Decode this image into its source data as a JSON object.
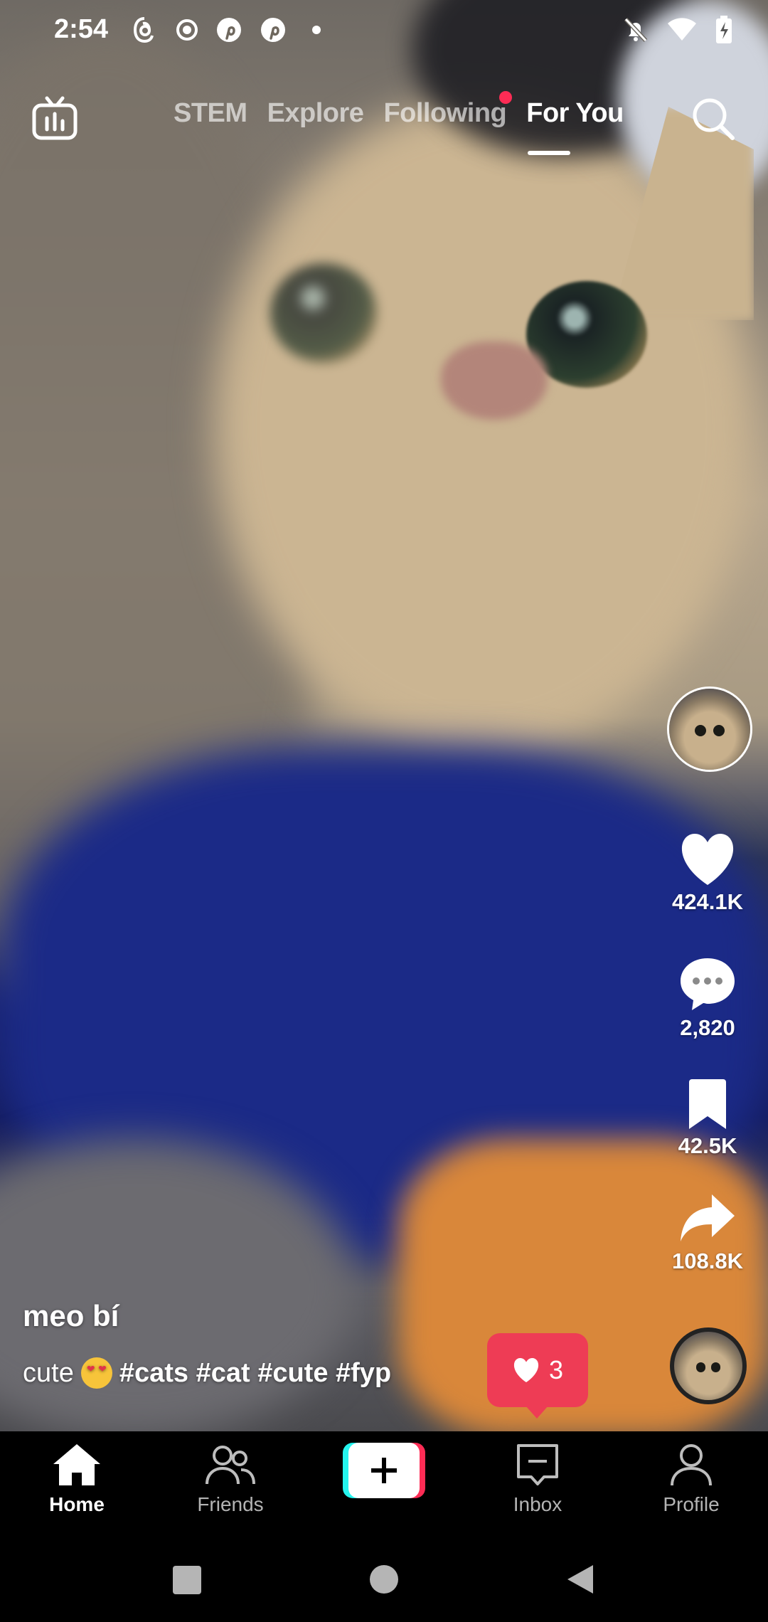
{
  "status_bar": {
    "time": "2:54",
    "left_icons": [
      "threads-icon",
      "record-icon",
      "pinterest-icon",
      "pinterest-icon",
      "dot-icon"
    ],
    "right_icons": [
      "bell-off-icon",
      "wifi-icon",
      "battery-charging-icon"
    ]
  },
  "top_nav": {
    "tabs": [
      "STEM",
      "Explore",
      "Following",
      "For You"
    ],
    "active_tab": "For You",
    "following_has_notification": true
  },
  "actions": {
    "likes": "424.1K",
    "comments": "2,820",
    "saves": "42.5K",
    "shares": "108.8K"
  },
  "caption": {
    "username": "meo bí",
    "text": "cute",
    "hashtags": "#cats #cat #cute #fyp"
  },
  "like_bubble": {
    "count": "3"
  },
  "bottom_nav": {
    "home": "Home",
    "friends": "Friends",
    "inbox": "Inbox",
    "profile": "Profile"
  },
  "colors": {
    "accent": "#fe2c55",
    "create_cyan": "#25f4ee",
    "bubble": "#ee3c55"
  }
}
